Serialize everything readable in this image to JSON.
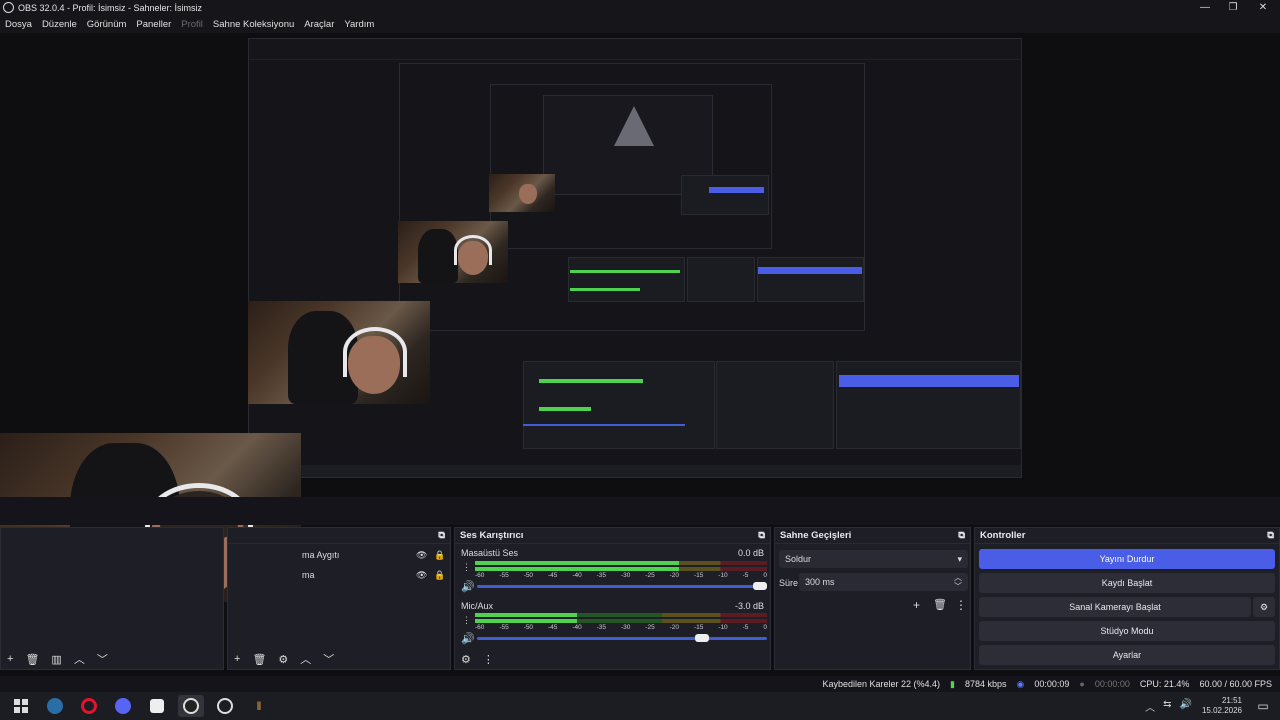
{
  "window": {
    "title": "OBS 32.0.4 - Profil: İsimsiz - Sahneler: İsimsiz",
    "minimize": "—",
    "maximize": "❐",
    "close": "✕"
  },
  "menu": [
    "Dosya",
    "Düzenle",
    "Görünüm",
    "Paneller",
    "Profil",
    "Sahne Koleksiyonu",
    "Araçlar",
    "Yardım"
  ],
  "sources": {
    "rows": [
      "ma Aygıtı",
      "ma"
    ]
  },
  "mixer": {
    "title": "Ses Karıştırıcı",
    "tracks": [
      {
        "name": "Masaüstü Ses",
        "db": "0.0 dB",
        "level": 0.7,
        "volume": 1.0
      },
      {
        "name": "Mic/Aux",
        "db": "-3.0 dB",
        "level": 0.35,
        "volume": 0.8
      }
    ],
    "ticks": [
      "-60",
      "-55",
      "-50",
      "-45",
      "-40",
      "-35",
      "-30",
      "-25",
      "-20",
      "-15",
      "-10",
      "-5",
      "0"
    ]
  },
  "transitions": {
    "title": "Sahne Geçişleri",
    "selected": "Soldur",
    "duration_label": "Süre",
    "duration": "300 ms"
  },
  "controls": {
    "title": "Kontroller",
    "buttons": [
      "Yayını Durdur",
      "Kaydı Başlat",
      "Sanal Kamerayı Başlat",
      "Stüdyo Modu",
      "Ayarlar"
    ]
  },
  "status": {
    "dropped": "Kaybedilen Kareler 22 (%4.4)",
    "bitrate": "8784 kbps",
    "stream_time": "00:00:09",
    "rec_time": "00:00:00",
    "cpu": "CPU: 21.4%",
    "fps": "60.00 / 60.00 FPS"
  },
  "clock": {
    "time": "21:51",
    "date": "15.02.2026"
  },
  "colors": {
    "accent": "#4a5de6",
    "meter_green": "#4fd24f",
    "bg": "#1e1e26"
  }
}
